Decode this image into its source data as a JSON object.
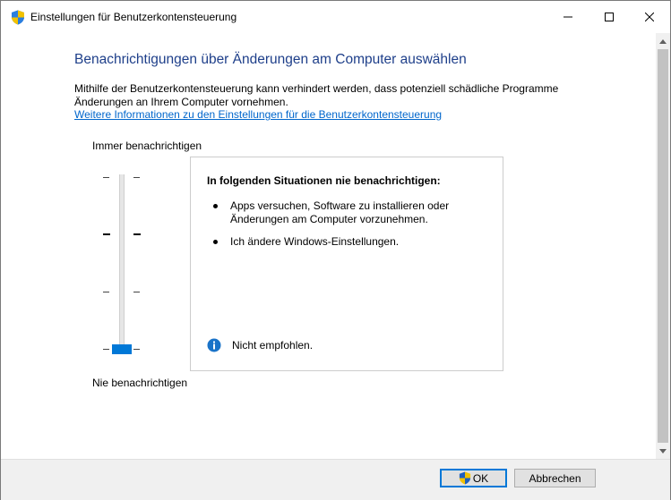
{
  "window": {
    "title": "Einstellungen für Benutzerkontensteuerung"
  },
  "main": {
    "heading": "Benachrichtigungen über Änderungen am Computer auswählen",
    "description": "Mithilfe der Benutzerkontensteuerung kann verhindert werden, dass potenziell schädliche Programme Änderungen an Ihrem Computer vornehmen.",
    "link": "Weitere Informationen zu den Einstellungen für die Benutzerkontensteuerung",
    "slider": {
      "top_label": "Immer benachrichtigen",
      "bottom_label": "Nie benachrichtigen",
      "levels": 4,
      "selected_level": 1
    },
    "infobox": {
      "title": "In folgenden Situationen nie benachrichtigen:",
      "items": [
        "Apps versuchen, Software zu installieren oder Änderungen am Computer vorzunehmen.",
        "Ich ändere Windows-Einstellungen."
      ],
      "note": "Nicht empfohlen."
    }
  },
  "footer": {
    "ok_label": "OK",
    "cancel_label": "Abbrechen"
  },
  "icons": {
    "title": "uac-shield-icon",
    "info": "info-icon",
    "ok": "uac-shield-icon"
  },
  "colors": {
    "heading": "#1e3f8a",
    "link": "#0066cc",
    "accent": "#0078d7"
  }
}
